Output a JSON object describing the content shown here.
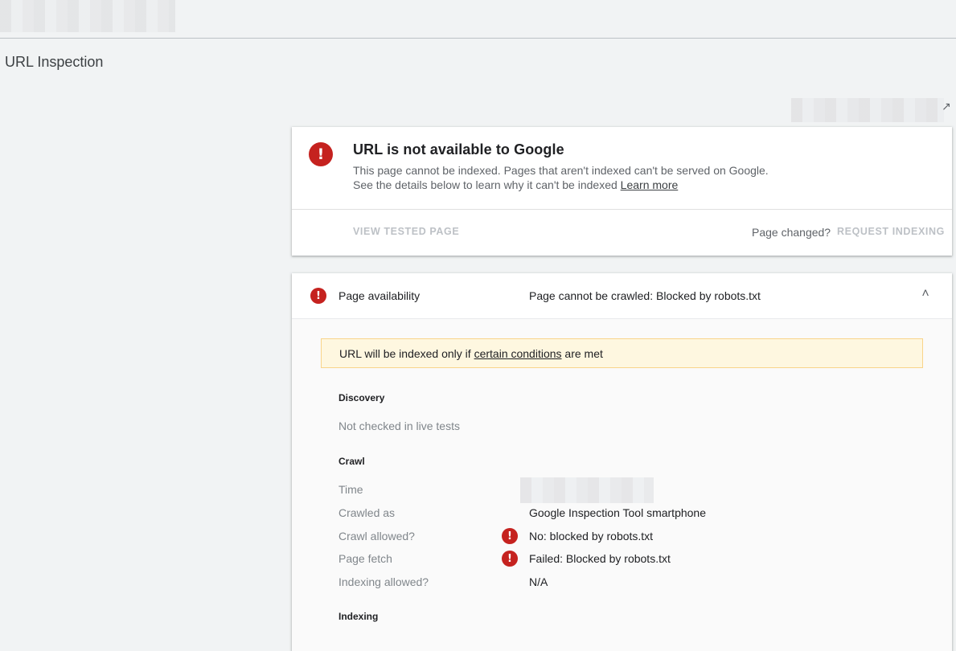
{
  "page": {
    "title": "URL Inspection"
  },
  "summary": {
    "title": "URL is not available to Google",
    "description": "This page cannot be indexed. Pages that aren't indexed can't be served on Google. See the details below to learn why it can't be indexed",
    "learn_more": "Learn more",
    "view_tested_page": "VIEW TESTED PAGE",
    "page_changed": "Page changed?",
    "request_indexing": "REQUEST INDEXING"
  },
  "availability": {
    "label": "Page availability",
    "status": "Page cannot be crawled: Blocked by robots.txt",
    "notice_prefix": "URL will be indexed only if",
    "notice_link": "certain conditions",
    "notice_suffix": "are met"
  },
  "discovery": {
    "heading": "Discovery",
    "text": "Not checked in live tests"
  },
  "crawl": {
    "heading": "Crawl",
    "rows": [
      {
        "label": "Time",
        "value": ""
      },
      {
        "label": "Crawled as",
        "value": "Google Inspection Tool smartphone"
      },
      {
        "label": "Crawl allowed?",
        "value": "No: blocked by robots.txt"
      },
      {
        "label": "Page fetch",
        "value": "Failed: Blocked by robots.txt"
      },
      {
        "label": "Indexing allowed?",
        "value": "N/A"
      }
    ]
  },
  "indexing": {
    "heading": "Indexing"
  },
  "icons": {
    "error": "error-exclamation-icon",
    "collapse": "chevron-up-icon",
    "expand": "expand-icon"
  },
  "colors": {
    "error": "#c5221f",
    "notice_bg": "#fef7e0",
    "notice_border": "#f9d48a",
    "background": "#f1f3f4"
  }
}
